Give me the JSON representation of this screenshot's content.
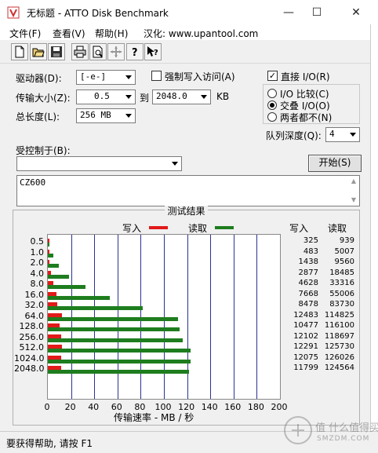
{
  "window": {
    "title": "无标题 - ATTO Disk Benchmark",
    "minimize": "—",
    "maximize": "☐",
    "close": "✕"
  },
  "menu": [
    {
      "label": "文件(F)"
    },
    {
      "label": "查看(V)"
    },
    {
      "label": "帮助(H)"
    },
    {
      "label": "汉化: www.upantool.com"
    }
  ],
  "toolbar": {
    "buttons": [
      "new-icon",
      "open-icon",
      "save-icon",
      "print-icon",
      "print-preview-icon",
      "move-icon",
      "help-icon",
      "context-help-icon"
    ]
  },
  "settings": {
    "drive_label": "驱动器(D):",
    "drive_value": "[-e-]",
    "force_write_label": "强制写入访问(A)",
    "force_write_checked": false,
    "transfer_label": "传输大小(Z):",
    "transfer_from": "0.5",
    "to_label": "到",
    "transfer_to": "2048.0",
    "kb_label": "KB",
    "total_label": "总长度(L):",
    "total_value": "256 MB",
    "direct_io_label": "直接 I/O(R)",
    "direct_io_checked": true,
    "io_compare_label": "I/O 比较(C)",
    "overlap_label": "交叠 I/O(O)",
    "neither_label": "两者都不(N)",
    "selected_mode": "overlap",
    "queue_label": "队列深度(Q):",
    "queue_value": "4",
    "controlled_label": "受控制于(B):",
    "controlled_value": "",
    "start_label": "开始(S)",
    "notes_text": "CZ600"
  },
  "results": {
    "title": "测试结果",
    "legend_write": "写入",
    "legend_read": "读取",
    "col_write": "写入",
    "col_read": "读取",
    "xlabel": "传输速率 - MB / 秒",
    "rows": [
      {
        "size": "0.5",
        "write": "325",
        "read": "939"
      },
      {
        "size": "1.0",
        "write": "483",
        "read": "5007"
      },
      {
        "size": "2.0",
        "write": "1438",
        "read": "9560"
      },
      {
        "size": "4.0",
        "write": "2877",
        "read": "18485"
      },
      {
        "size": "8.0",
        "write": "4628",
        "read": "33316"
      },
      {
        "size": "16.0",
        "write": "7668",
        "read": "55006"
      },
      {
        "size": "32.0",
        "write": "8478",
        "read": "83730"
      },
      {
        "size": "64.0",
        "write": "12483",
        "read": "114825"
      },
      {
        "size": "128.0",
        "write": "10477",
        "read": "116100"
      },
      {
        "size": "256.0",
        "write": "12102",
        "read": "118697"
      },
      {
        "size": "512.0",
        "write": "12291",
        "read": "125730"
      },
      {
        "size": "1024.0",
        "write": "12075",
        "read": "126026"
      },
      {
        "size": "2048.0",
        "write": "11799",
        "read": "124564"
      }
    ]
  },
  "chart_data": {
    "type": "bar",
    "orientation": "horizontal",
    "categories": [
      "0.5",
      "1.0",
      "2.0",
      "4.0",
      "8.0",
      "16.0",
      "32.0",
      "64.0",
      "128.0",
      "256.0",
      "512.0",
      "1024.0",
      "2048.0"
    ],
    "series": [
      {
        "name": "写入",
        "color": "#e21a1a",
        "values": [
          0.3,
          0.5,
          1.4,
          2.8,
          4.5,
          7.5,
          8.3,
          12.2,
          10.2,
          11.8,
          12.0,
          11.8,
          11.5
        ]
      },
      {
        "name": "读取",
        "color": "#1e7d1e",
        "values": [
          0.9,
          4.9,
          9.3,
          18.1,
          32.5,
          53.7,
          81.8,
          112.1,
          113.4,
          115.9,
          122.8,
          123.1,
          121.6
        ]
      }
    ],
    "xlabel": "传输速率 - MB / 秒",
    "xlim": [
      0,
      200
    ],
    "xticks": [
      "0",
      "20",
      "40",
      "60",
      "80",
      "100",
      "120",
      "140",
      "160",
      "180",
      "200"
    ],
    "grid": true,
    "legend": "top"
  },
  "status": {
    "text": "要获得帮助, 请按 F1"
  },
  "watermark": {
    "text1": "值 什么值得买",
    "text2": "SMZDM.COM"
  }
}
